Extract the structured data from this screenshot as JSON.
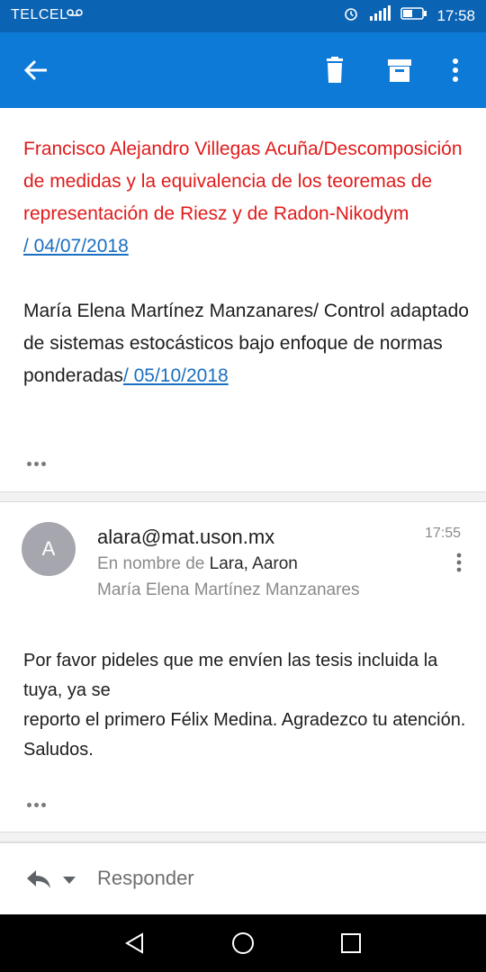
{
  "status_bar": {
    "carrier": "TELCEL",
    "time": "17:58"
  },
  "app_bar": {
    "icons": [
      "back-arrow-icon",
      "trash-icon",
      "archive-icon",
      "more-vert-icon"
    ],
    "color": "#0e7ad8"
  },
  "message1": {
    "item1_text": "Francisco Alejandro Villegas Acuña/Descomposición de medidas y la equivalencia de los teoremas de representación de Riesz y de Radon-Nikodym",
    "item1_link": "/ 04/07/2018",
    "item2_text": "María Elena Martínez Manzanares/ Control adaptado de sistemas estocásticos bajo enfoque de normas ponderadas",
    "item2_link": "/ 05/10/2018"
  },
  "message2": {
    "avatar_letter": "A",
    "sender": "alara@mat.uson.mx",
    "on_behalf_prefix": "En nombre de",
    "on_behalf_name": "Lara, Aaron",
    "recipient": "María Elena Martínez Manzanares",
    "time": "17:55",
    "body_line1": "Por favor pideles que me envíen las tesis incluida la tuya, ya se",
    "body_line2": "reporto el primero Félix Medina. Agradezco tu atención. Saludos."
  },
  "reply_bar": {
    "label": "Responder"
  },
  "colors": {
    "red_text": "#e01b1b",
    "link": "#1a6fc0",
    "status_bar": "#0b63b3"
  }
}
